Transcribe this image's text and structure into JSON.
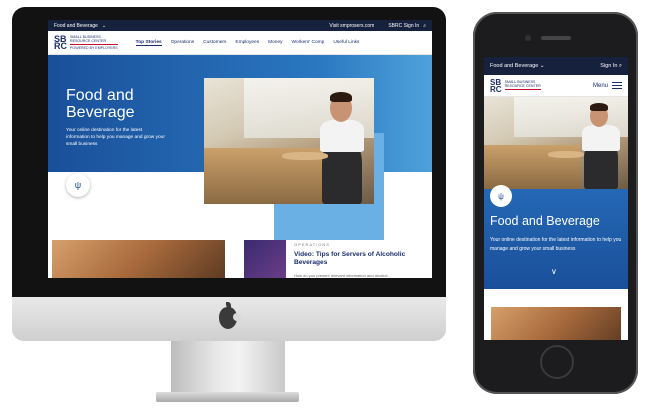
{
  "desktop": {
    "topbar": {
      "section": "Food and Beverage",
      "link": "Visit smprosers.com",
      "signin": "SBRC Sign In"
    },
    "logo": {
      "mark_top": "SB",
      "mark_bottom": "RC",
      "line1": "SMALL BUSINESS",
      "line2": "RESOURCE CENTER",
      "line3": "POWERED BY EMPLOYERS"
    },
    "nav": [
      "Top Stories",
      "Operations",
      "Customers",
      "Employees",
      "Money",
      "Workers' Comp",
      "Useful Links"
    ],
    "hero": {
      "title": "Food and Beverage",
      "text": "Your online destination for the latest information to help you manage and grow your small business"
    },
    "article": {
      "category": "OPERATIONS",
      "title": "Video: Tips for Servers of Alcoholic Beverages",
      "teaser": "How do you present relevant information and alcohol..."
    }
  },
  "mobile": {
    "topbar": {
      "section": "Food and Beverage",
      "signin": "Sign In"
    },
    "menu": "Menu",
    "hero": {
      "title": "Food and Beverage",
      "text": "Your online destination for the latest information to help you manage and grow your small business"
    }
  },
  "icons": {
    "dropdown": "chevron-down-icon",
    "search": "search-icon",
    "utensils": "fork-knife-icon",
    "hamburger": "menu-icon",
    "scroll": "chevron-down-icon"
  },
  "colors": {
    "navy": "#16213e",
    "brand_blue": "#1a4f9a",
    "accent_red": "#c8102e",
    "light_blue": "#6ab0e4"
  }
}
